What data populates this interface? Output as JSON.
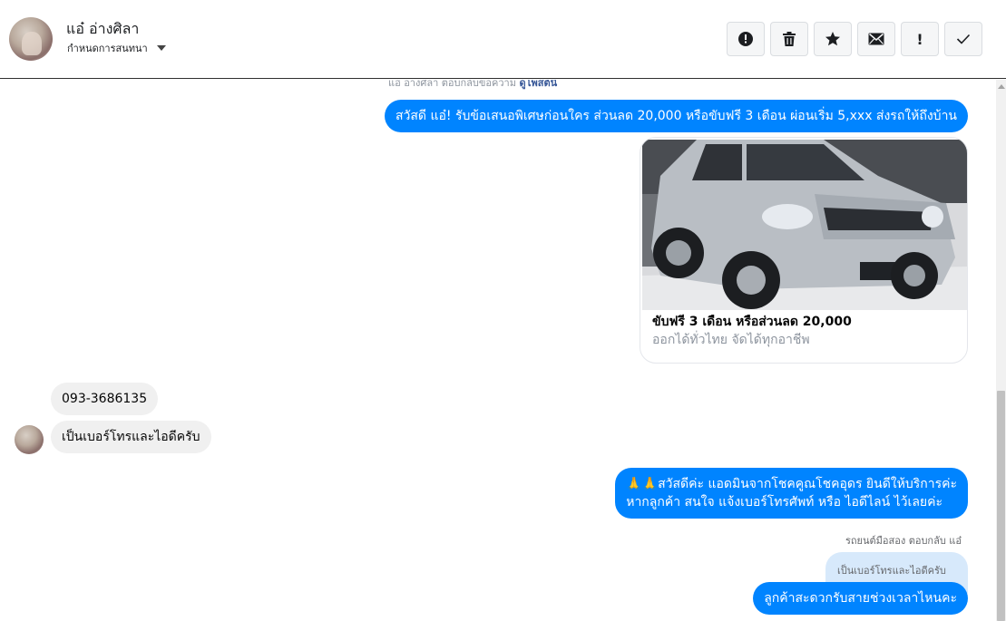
{
  "header": {
    "contact_name": "แอ๋ อ่างศิลา",
    "assign_label": "กำหนดการสนทนา",
    "toolbar": [
      {
        "name": "mark-spam",
        "icon": "alert-circle-icon"
      },
      {
        "name": "delete",
        "icon": "trash-icon"
      },
      {
        "name": "star",
        "icon": "star-icon"
      },
      {
        "name": "mark-unread",
        "icon": "mail-icon"
      },
      {
        "name": "follow-up",
        "icon": "exclamation-icon",
        "glyph": "!"
      },
      {
        "name": "mark-done",
        "icon": "check-icon"
      }
    ]
  },
  "chat": {
    "cut_text": "แอ๋ อ่างศิลา ตอบกลับข้อความ",
    "cut_link": "ดูโพสต์นี้",
    "messages": {
      "m1": "สวัสดี แอ๋! รับข้อเสนอพิเศษก่อนใคร ส่วนลด 20,000 หรือขับฟรี 3 เดือน ผ่อนเริ่ม 5,xxx ส่งรถให้ถึงบ้าน",
      "card_title": "ขับฟรี 3 เดือน หรือส่วนลด 20,000",
      "card_subtitle": "ออกได้ทั่วไทย จัดได้ทุกอาชีพ",
      "in1": "093-3686135",
      "in2": "เป็นเบอร์โทรและไอดีครับ",
      "out2_line1": "🙏🙏สวัสดีค่ะ แอดมินจากโชคคูณโชคอุดร ยินดีให้บริการค่ะ",
      "out2_line2": "หากลูกค้า สนใจ แจ้งเบอร์โทรศัพท์ หรือ ไอดีไลน์  ไว้เลยค่ะ",
      "sent_by": "รถยนต์มือสอง ตอบกลับ แอ๋",
      "reply_quote": "เป็นเบอร์โทรและไอดีครับ",
      "out3": "ลูกค้าสะดวกรับสายช่วงเวลาไหนคะ"
    }
  },
  "colors": {
    "outgoing_bubble": "#0084ff",
    "incoming_bubble": "#f0f0f0",
    "reply_quote_bg": "#d7e9fb"
  }
}
